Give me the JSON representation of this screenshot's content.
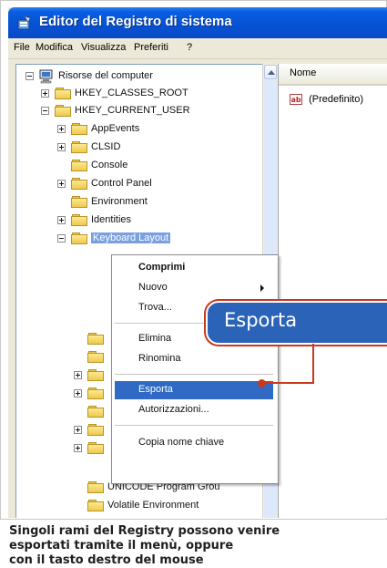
{
  "window": {
    "title": "Editor del Registro di sistema"
  },
  "menubar": {
    "items": [
      "File",
      "Modifica",
      "Visualizza",
      "Preferiti",
      "?"
    ]
  },
  "tree": {
    "root": "Risorse del computer",
    "nodes": [
      {
        "label": "HKEY_CLASSES_ROOT"
      },
      {
        "label": "HKEY_CURRENT_USER"
      },
      {
        "label": "AppEvents"
      },
      {
        "label": "CLSID"
      },
      {
        "label": "Console"
      },
      {
        "label": "Control Panel"
      },
      {
        "label": "Environment"
      },
      {
        "label": "Identities"
      },
      {
        "label": "Keyboard Layout"
      },
      {
        "label": "UNICODE Program Grou"
      },
      {
        "label": "Volatile Environment"
      }
    ]
  },
  "list": {
    "header_name": "Nome",
    "values": [
      "(Predefinito)"
    ]
  },
  "context_menu": {
    "items": [
      "Comprimi",
      "Nuovo",
      "Trova...",
      "Elimina",
      "Rinomina",
      "Esporta",
      "Autorizzazioni...",
      "Copia nome chiave"
    ],
    "highlighted": "Esporta"
  },
  "callout": {
    "label": "Esporta"
  },
  "caption": {
    "lines": [
      "Singoli rami del Registry possono venire",
      "esportati tramite il menù, oppure",
      "con il tasto destro del mouse"
    ]
  },
  "colors": {
    "titlebar": "#0552d4",
    "menu_highlight": "#316ac5",
    "callout_fill": "#2b63b8",
    "callout_border": "#c8391e"
  },
  "icons": [
    "regedit-icon",
    "computer-icon",
    "folder-icon",
    "string-value-icon",
    "submenu-arrow-icon",
    "scroll-up-arrow-icon"
  ]
}
